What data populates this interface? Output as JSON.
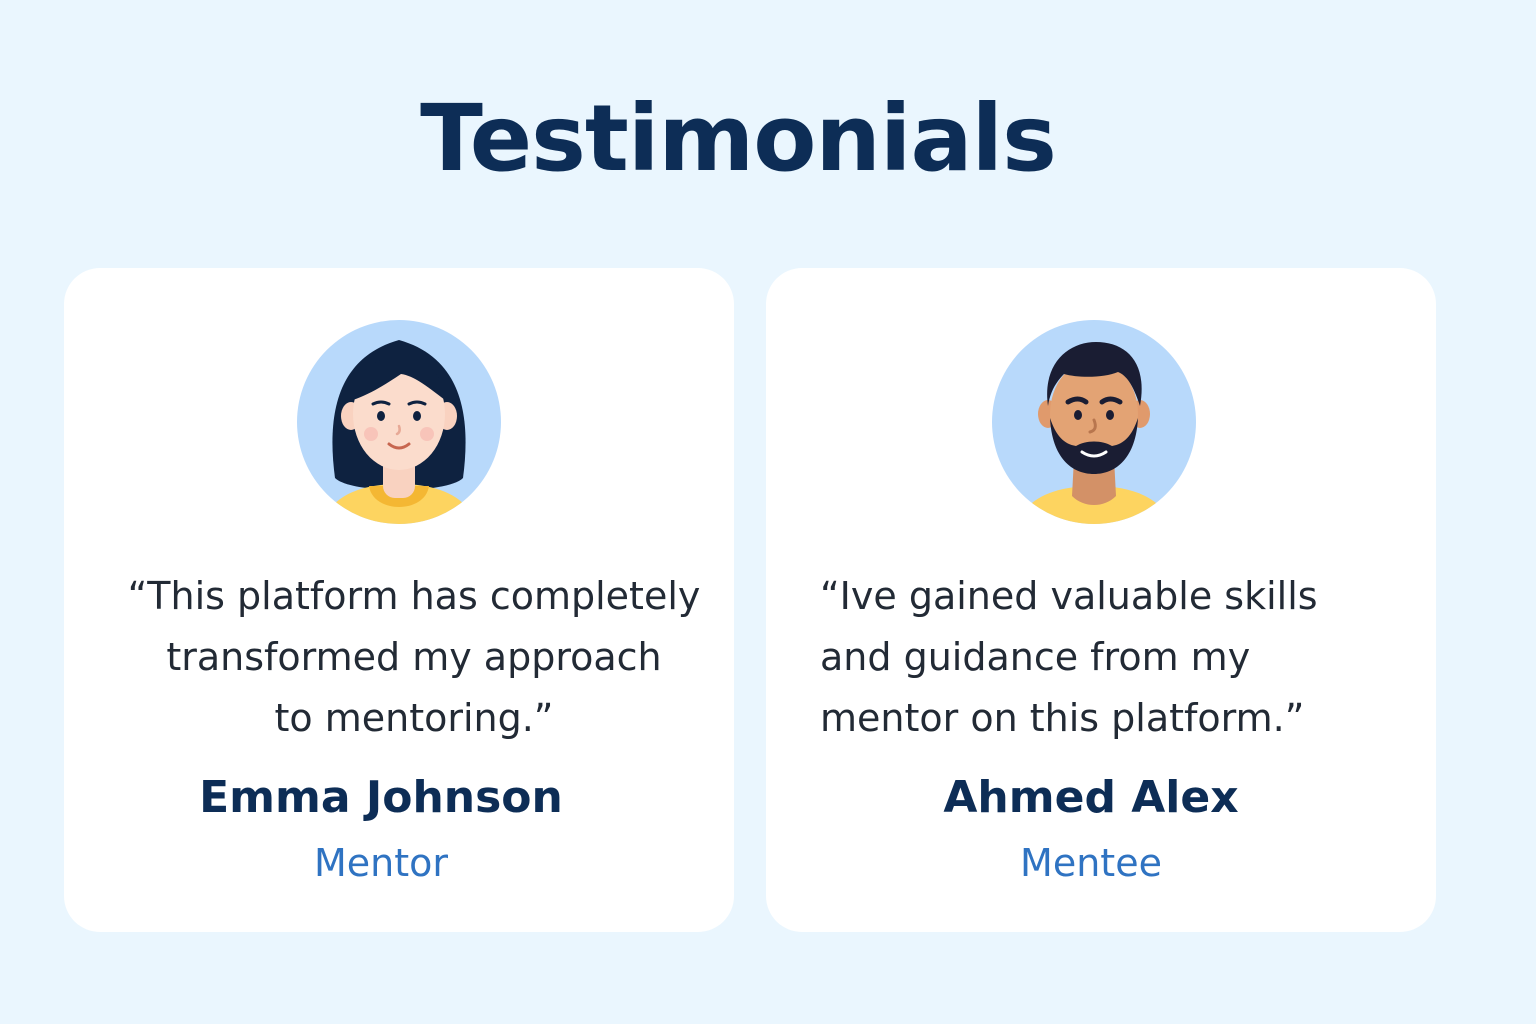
{
  "header": {
    "title": "Testimonials"
  },
  "testimonials": [
    {
      "avatar_icon": "woman-avatar-icon",
      "quote": "“This platform has completely\n  transformed my approach\nto mentoring.”",
      "name": "Emma Johnson",
      "role": "Mentor"
    },
    {
      "avatar_icon": "man-avatar-icon",
      "quote": "“Ive gained valuable skills\nand guidance from my\nmentor on this platform.”",
      "name": "Ahmed Alex",
      "role": "Mentee"
    }
  ],
  "colors": {
    "background": "#eaf6fe",
    "card": "#ffffff",
    "heading": "#0d2d56",
    "role_text": "#2f73c2",
    "avatar_bg": "#b8d9fb",
    "shirt": "#fdd460"
  }
}
